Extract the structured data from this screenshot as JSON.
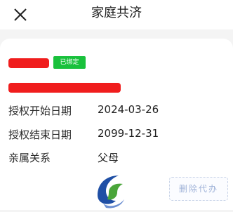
{
  "header": {
    "title": "家庭共济",
    "close_icon": "close-icon"
  },
  "card": {
    "status_badge": "已绑定",
    "rows": [
      {
        "label": "授权开始日期",
        "value": "2024-03-26"
      },
      {
        "label": "授权结束日期",
        "value": "2099-12-31"
      },
      {
        "label": "亲属关系",
        "value": "父母"
      }
    ],
    "stamp_text": "删除代办"
  },
  "colors": {
    "badge": "#19c13c",
    "redaction": "#f01d1d",
    "logo_blue": "#1f4fa5",
    "logo_green": "#4aa53a"
  }
}
